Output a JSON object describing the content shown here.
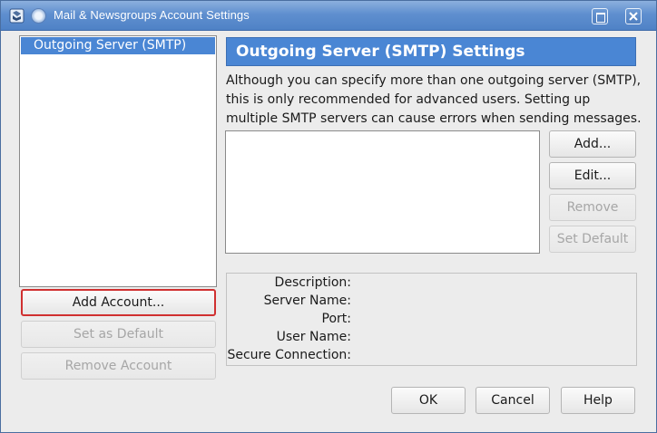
{
  "window": {
    "title": "Mail & Newsgroups Account Settings"
  },
  "accounts": {
    "items": [
      "Outgoing Server (SMTP)"
    ],
    "selected_index": 0
  },
  "account_buttons": {
    "add": "Add Account...",
    "set_default": "Set as Default",
    "remove": "Remove Account"
  },
  "panel": {
    "heading": "Outgoing Server (SMTP) Settings",
    "description": "Although you can specify more than one outgoing server (SMTP), this is only recommended for advanced users. Setting up multiple SMTP servers can cause errors when sending messages."
  },
  "server_buttons": {
    "add": "Add...",
    "edit": "Edit...",
    "remove": "Remove",
    "set_default": "Set Default"
  },
  "details": {
    "description_label": "Description:",
    "server_name_label": "Server Name:",
    "port_label": "Port:",
    "user_name_label": "User Name:",
    "secure_connection_label": "Secure Connection:"
  },
  "dialog_buttons": {
    "ok": "OK",
    "cancel": "Cancel",
    "help": "Help"
  },
  "colors": {
    "title_bar": "#5f8fcf",
    "selection": "#4a86d4",
    "focus_border": "#d03030"
  }
}
